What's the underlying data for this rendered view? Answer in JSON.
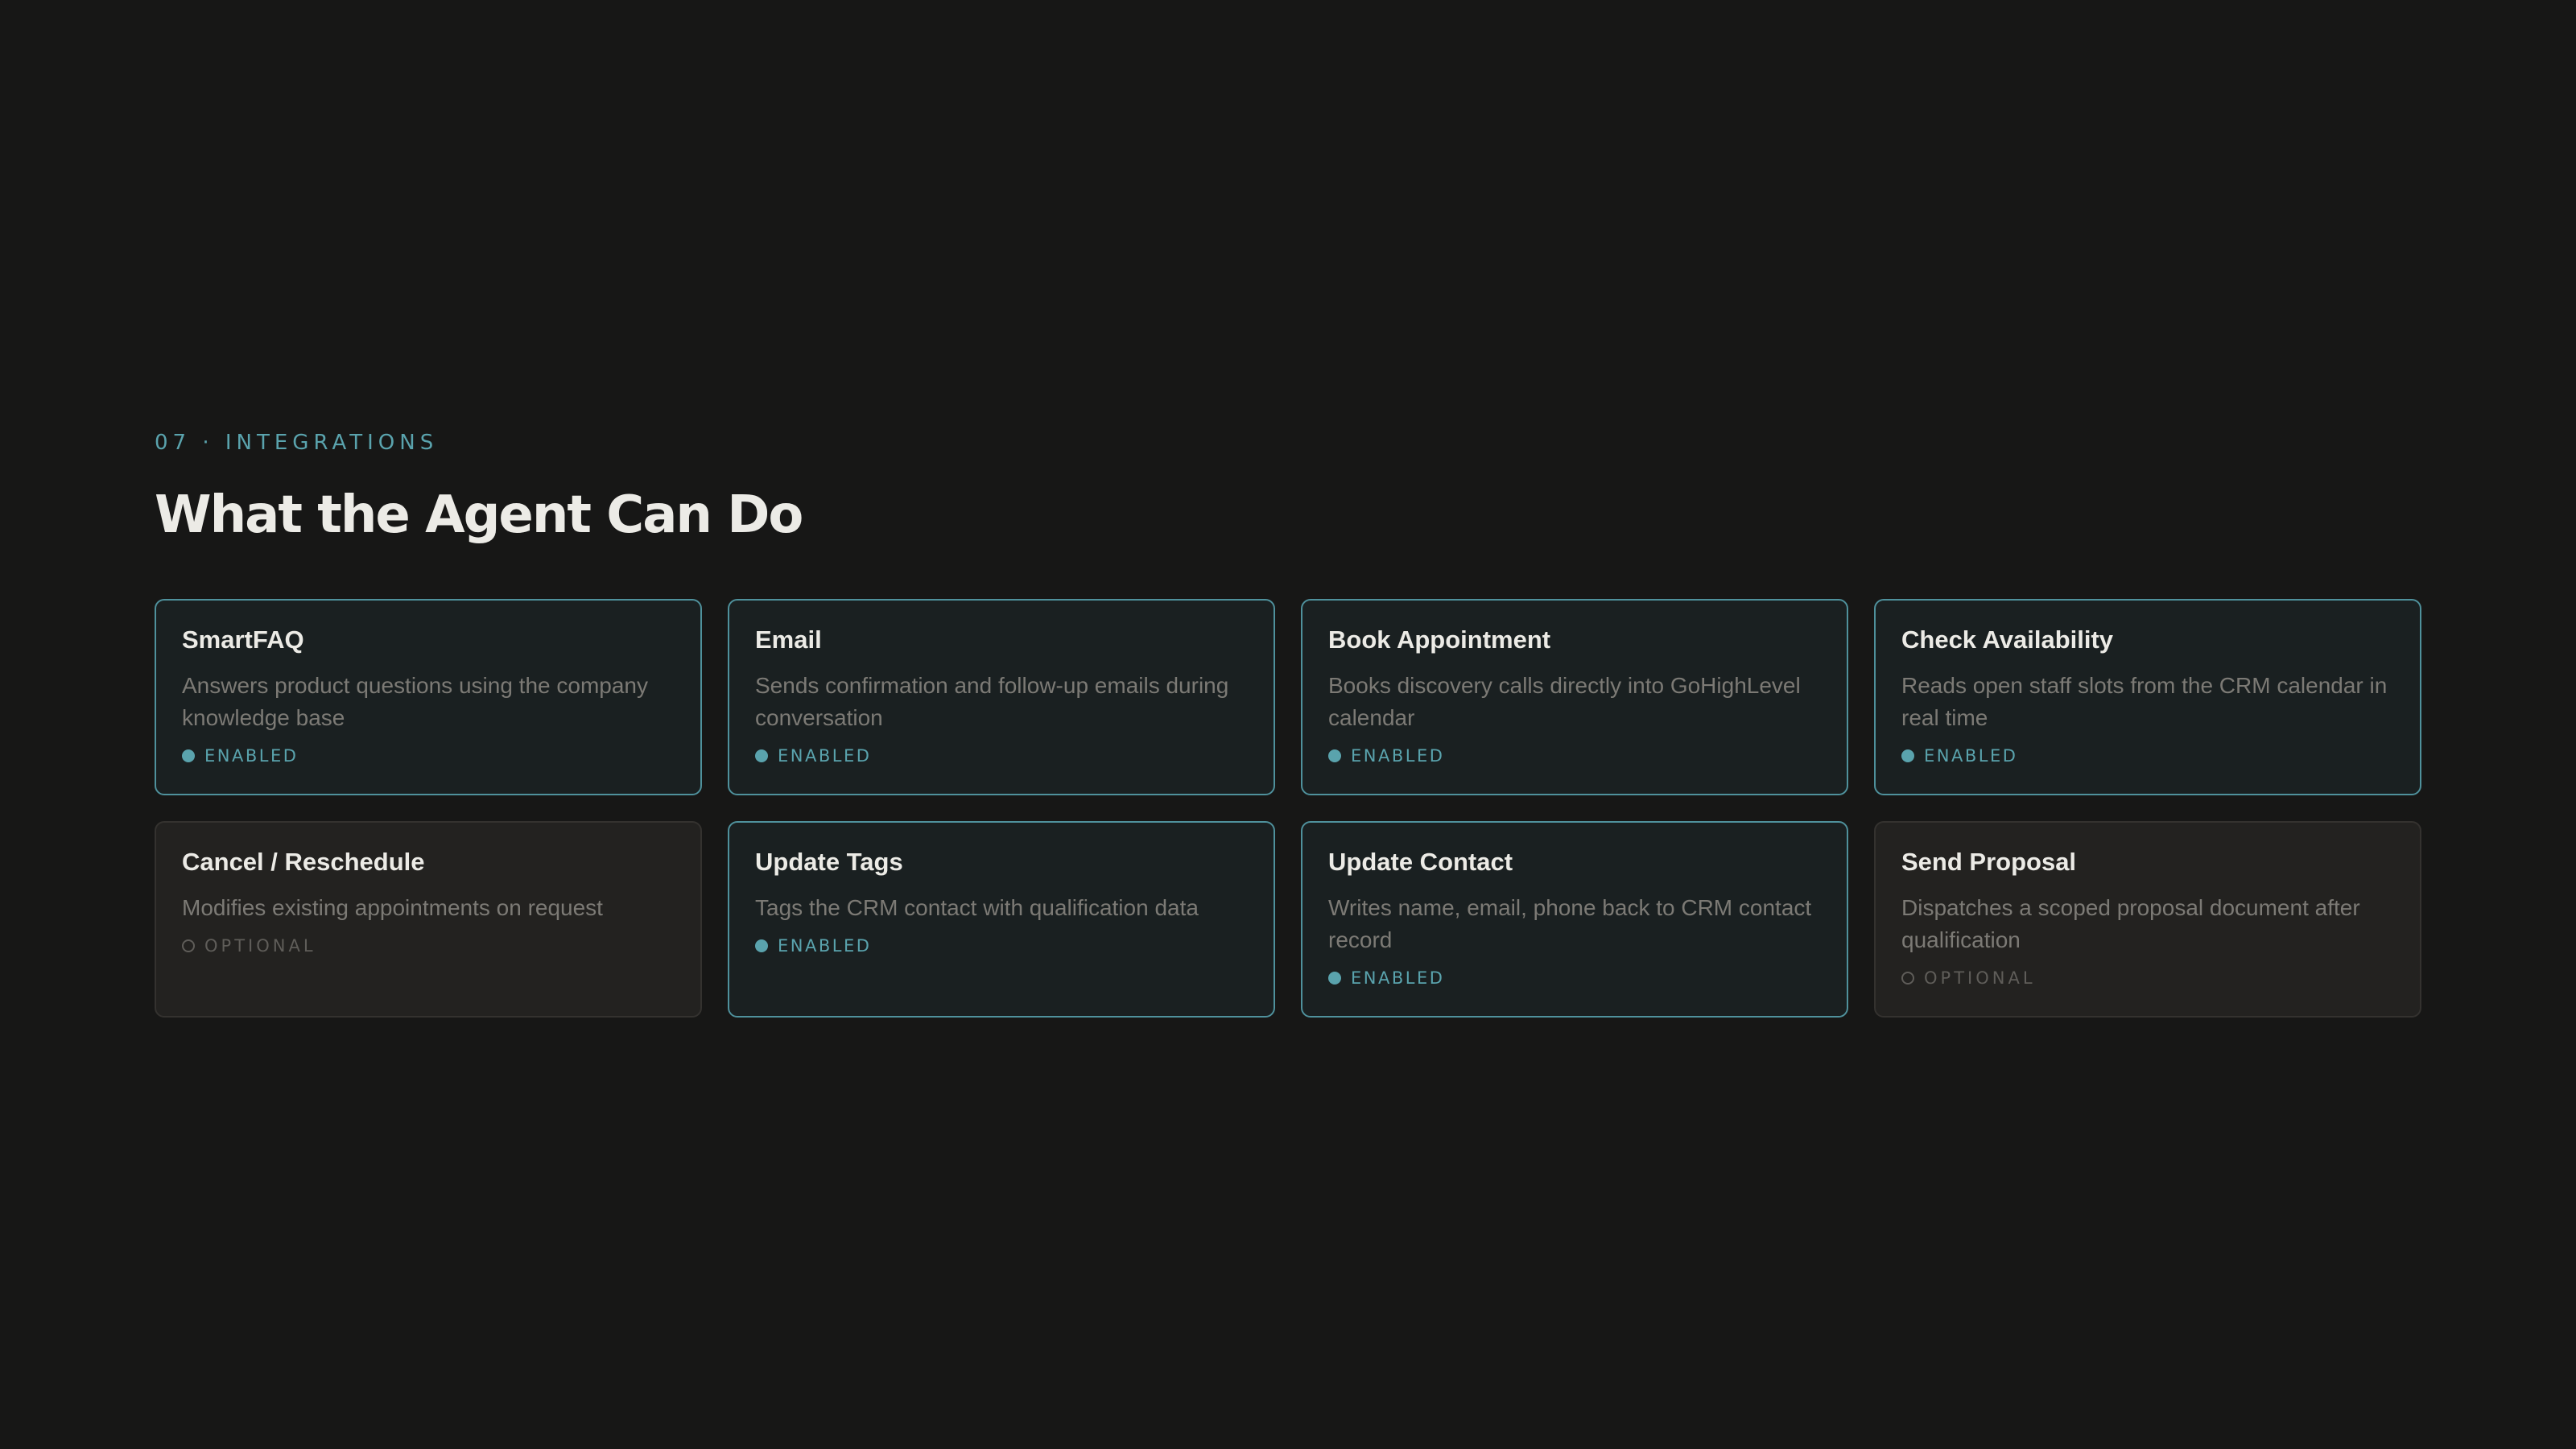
{
  "section": {
    "eyebrow": "07 · INTEGRATIONS",
    "title": "What the Agent Can Do"
  },
  "colors": {
    "background": "#171716",
    "accent": "#5aa3ad",
    "enabled_border": "#4f919c",
    "optional_text": "#5f5d59"
  },
  "cards": [
    {
      "title": "SmartFAQ",
      "description": "Answers product questions using the company knowledge base",
      "status": "ENABLED",
      "state": "enabled",
      "icon": "filled-dot-icon"
    },
    {
      "title": "Email",
      "description": "Sends confirmation and follow-up emails during conversation",
      "status": "ENABLED",
      "state": "enabled",
      "icon": "filled-dot-icon"
    },
    {
      "title": "Book Appointment",
      "description": "Books discovery calls directly into GoHighLevel calendar",
      "status": "ENABLED",
      "state": "enabled",
      "icon": "filled-dot-icon"
    },
    {
      "title": "Check Availability",
      "description": "Reads open staff slots from the CRM calendar in real time",
      "status": "ENABLED",
      "state": "enabled",
      "icon": "filled-dot-icon"
    },
    {
      "title": "Cancel / Reschedule",
      "description": "Modifies existing appointments on request",
      "status": "OPTIONAL",
      "state": "optional",
      "icon": "hollow-dot-icon"
    },
    {
      "title": "Update Tags",
      "description": "Tags the CRM contact with qualification data",
      "status": "ENABLED",
      "state": "enabled",
      "icon": "filled-dot-icon"
    },
    {
      "title": "Update Contact",
      "description": "Writes name, email, phone back to CRM contact record",
      "status": "ENABLED",
      "state": "enabled",
      "icon": "filled-dot-icon"
    },
    {
      "title": "Send Proposal",
      "description": "Dispatches a scoped proposal document after qualification",
      "status": "OPTIONAL",
      "state": "optional",
      "icon": "hollow-dot-icon"
    }
  ]
}
